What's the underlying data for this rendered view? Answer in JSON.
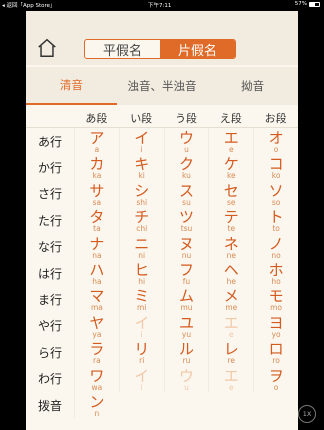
{
  "status": {
    "left": "◂ 返回「App Store」",
    "time": "下午7:11",
    "battery": "57%"
  },
  "header": {
    "segments": [
      {
        "label": "平假名",
        "active": false
      },
      {
        "label": "片假名",
        "active": true
      }
    ]
  },
  "tabs": [
    {
      "label": "清音",
      "active": true
    },
    {
      "label": "浊音、半浊音",
      "active": false
    },
    {
      "label": "拗音",
      "active": false
    }
  ],
  "columns": [
    "あ段",
    "い段",
    "う段",
    "え段",
    "お段"
  ],
  "rows": [
    {
      "label": "あ行",
      "cells": [
        {
          "k": "ア",
          "r": "a"
        },
        {
          "k": "イ",
          "r": "i"
        },
        {
          "k": "ウ",
          "r": "u"
        },
        {
          "k": "エ",
          "r": "e"
        },
        {
          "k": "オ",
          "r": "o"
        }
      ]
    },
    {
      "label": "か行",
      "cells": [
        {
          "k": "カ",
          "r": "ka"
        },
        {
          "k": "キ",
          "r": "ki"
        },
        {
          "k": "ク",
          "r": "ku"
        },
        {
          "k": "ケ",
          "r": "ke"
        },
        {
          "k": "コ",
          "r": "ko"
        }
      ]
    },
    {
      "label": "さ行",
      "cells": [
        {
          "k": "サ",
          "r": "sa"
        },
        {
          "k": "シ",
          "r": "shi"
        },
        {
          "k": "ス",
          "r": "su"
        },
        {
          "k": "セ",
          "r": "se"
        },
        {
          "k": "ソ",
          "r": "so"
        }
      ]
    },
    {
      "label": "た行",
      "cells": [
        {
          "k": "タ",
          "r": "ta"
        },
        {
          "k": "チ",
          "r": "chi"
        },
        {
          "k": "ツ",
          "r": "tsu"
        },
        {
          "k": "テ",
          "r": "te"
        },
        {
          "k": "ト",
          "r": "to"
        }
      ]
    },
    {
      "label": "な行",
      "cells": [
        {
          "k": "ナ",
          "r": "na"
        },
        {
          "k": "ニ",
          "r": "ni"
        },
        {
          "k": "ヌ",
          "r": "nu"
        },
        {
          "k": "ネ",
          "r": "ne"
        },
        {
          "k": "ノ",
          "r": "no"
        }
      ]
    },
    {
      "label": "は行",
      "cells": [
        {
          "k": "ハ",
          "r": "ha"
        },
        {
          "k": "ヒ",
          "r": "hi"
        },
        {
          "k": "フ",
          "r": "fu"
        },
        {
          "k": "ヘ",
          "r": "he"
        },
        {
          "k": "ホ",
          "r": "ho"
        }
      ]
    },
    {
      "label": "ま行",
      "cells": [
        {
          "k": "マ",
          "r": "ma"
        },
        {
          "k": "ミ",
          "r": "mi"
        },
        {
          "k": "ム",
          "r": "mu"
        },
        {
          "k": "メ",
          "r": "me"
        },
        {
          "k": "モ",
          "r": "mo"
        }
      ]
    },
    {
      "label": "や行",
      "cells": [
        {
          "k": "ヤ",
          "r": "ya"
        },
        {
          "k": "イ",
          "r": "i",
          "faded": true
        },
        {
          "k": "ユ",
          "r": "yu"
        },
        {
          "k": "エ",
          "r": "e",
          "faded": true
        },
        {
          "k": "ヨ",
          "r": "yo"
        }
      ]
    },
    {
      "label": "ら行",
      "cells": [
        {
          "k": "ラ",
          "r": "ra"
        },
        {
          "k": "リ",
          "r": "ri"
        },
        {
          "k": "ル",
          "r": "ru"
        },
        {
          "k": "レ",
          "r": "re"
        },
        {
          "k": "ロ",
          "r": "ro"
        }
      ]
    },
    {
      "label": "わ行",
      "cells": [
        {
          "k": "ワ",
          "r": "wa"
        },
        {
          "k": "イ",
          "r": "i",
          "faded": true
        },
        {
          "k": "ウ",
          "r": "u",
          "faded": true
        },
        {
          "k": "エ",
          "r": "e",
          "faded": true
        },
        {
          "k": "ヲ",
          "r": "o"
        }
      ]
    },
    {
      "label": "拨音",
      "cells": [
        {
          "k": "ン",
          "r": "n"
        }
      ]
    }
  ],
  "zoom_label": "1X",
  "colors": {
    "accent": "#e06a28",
    "header_bg": "#f2ebdf",
    "page_bg": "#fbf7ef"
  }
}
